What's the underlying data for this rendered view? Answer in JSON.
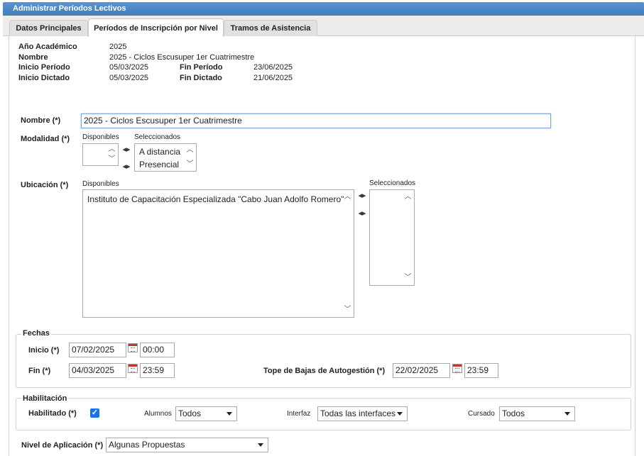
{
  "window": {
    "title": "Administrar Períodos Lectivos"
  },
  "tabs": [
    {
      "label": "Datos Principales"
    },
    {
      "label": "Períodos de Inscripción por Nivel"
    },
    {
      "label": "Tramos de Asistencia"
    }
  ],
  "summary": {
    "anio_label": "Año Académico",
    "anio_value": "2025",
    "nombre_label": "Nombre",
    "nombre_value": "2025 - Ciclos Escusuper 1er Cuatrimestre",
    "inicio_periodo_label": "Inicio Período",
    "inicio_periodo_value": "05/03/2025",
    "fin_periodo_label": "Fin Período",
    "fin_periodo_value": "23/06/2025",
    "inicio_dictado_label": "Inicio Dictado",
    "inicio_dictado_value": "05/03/2025",
    "fin_dictado_label": "Fin Dictado",
    "fin_dictado_value": "21/06/2025"
  },
  "form": {
    "nombre_label": "Nombre (*)",
    "nombre_value": "2025 - Ciclos Escusuper 1er Cuatrimestre",
    "modalidad_label": "Modalidad (*)",
    "modalidad_disponibles_label": "Disponibles",
    "modalidad_seleccionados_label": "Seleccionados",
    "modalidad_seleccionados": [
      "A distancia",
      "Presencial"
    ],
    "ubicacion_label": "Ubicación (*)",
    "ubicacion_disponibles_label": "Disponibles",
    "ubicacion_seleccionados_label": "Seleccionados",
    "ubicacion_disponibles": [
      "Instituto de Capacitación Especializada \"Cabo Juan Adolfo Romero\""
    ]
  },
  "fechas": {
    "legend": "Fechas",
    "inicio_label": "Inicio (*)",
    "inicio_date": "07/02/2025",
    "inicio_time": "00:00",
    "fin_label": "Fin (*)",
    "fin_date": "04/03/2025",
    "fin_time": "23:59",
    "tope_label": "Tope de Bajas de Autogestión (*)",
    "tope_date": "22/02/2025",
    "tope_time": "23:59"
  },
  "habilitacion": {
    "legend": "Habilitación",
    "habilitado_label": "Habilitado (*)",
    "habilitado_checked": true,
    "alumnos_label": "Alumnos",
    "alumnos_value": "Todos",
    "interfaz_label": "Interfaz",
    "interfaz_value": "Todas las interfaces",
    "cursado_label": "Cursado",
    "cursado_value": "Todos"
  },
  "nivel": {
    "label": "Nivel de Aplicación (*)",
    "value": "Algunas Propuestas"
  },
  "icons": {
    "move_right": "arrow-right-icon",
    "move_left": "arrow-left-icon",
    "calendar": "calendar-icon"
  },
  "colors": {
    "title_bar": "#3f7ec0",
    "checkbox": "#1a73e8"
  }
}
